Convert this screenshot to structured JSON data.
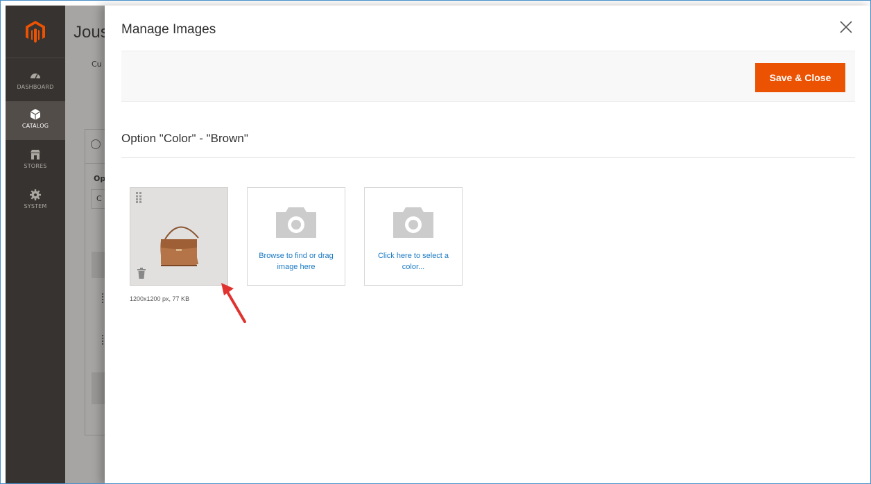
{
  "sidebar": {
    "items": [
      {
        "label": "DASHBOARD",
        "icon": "dashboard-icon"
      },
      {
        "label": "CATALOG",
        "icon": "catalog-icon",
        "active": true
      },
      {
        "label": "STORES",
        "icon": "stores-icon"
      },
      {
        "label": "SYSTEM",
        "icon": "system-icon"
      }
    ]
  },
  "background_page": {
    "title": "Jous",
    "breadcrumb": "Cu",
    "field_label": "Op",
    "field_value": "C"
  },
  "modal": {
    "title": "Manage Images",
    "save_label": "Save & Close",
    "section_title": "Option \"Color\" - \"Brown\"",
    "image_meta": "1200x1200 px, 77 KB",
    "browse_text": "Browse to find or drag image here",
    "color_text": "Click here to select a color..."
  },
  "colors": {
    "accent": "#eb5202",
    "link": "#1979c3",
    "sidebar_bg": "#373330"
  }
}
